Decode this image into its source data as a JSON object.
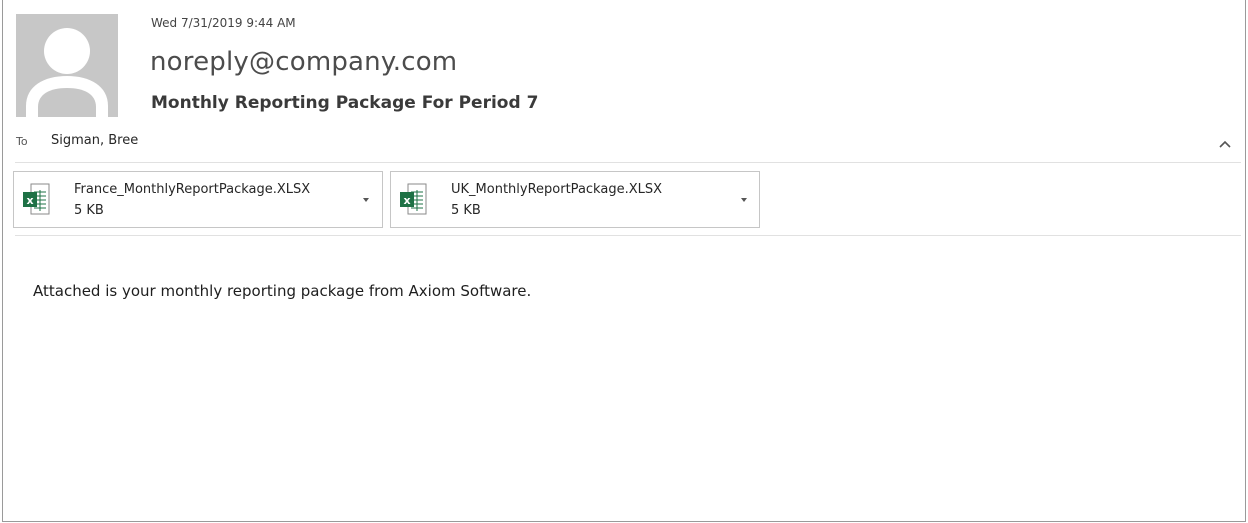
{
  "message": {
    "date": "Wed 7/31/2019 9:44 AM",
    "sender": "noreply@company.com",
    "subject": "Monthly Reporting Package For Period 7",
    "to_label": "To",
    "to_value": "Sigman, Bree",
    "body": "Attached is your monthly reporting package from Axiom Software."
  },
  "attachments": [
    {
      "name": "France_MonthlyReportPackage.XLSX",
      "size": "5 KB",
      "icon": "excel-file-icon"
    },
    {
      "name": "UK_MonthlyReportPackage.XLSX",
      "size": "5 KB",
      "icon": "excel-file-icon"
    }
  ],
  "colors": {
    "excel_green": "#1e7145",
    "avatar_bg": "#c7c7c7",
    "avatar_fg": "#ffffff"
  },
  "icons": {
    "avatar": "person-silhouette-icon",
    "collapse": "chevron-up-icon",
    "attachment_menu": "chevron-down-icon"
  }
}
